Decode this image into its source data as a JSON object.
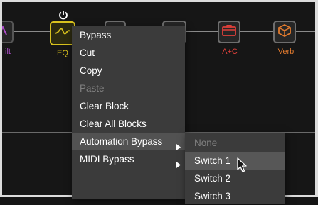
{
  "signal_chain": {
    "blocks": [
      {
        "label": "ilt",
        "color": "#b24fd0",
        "icon": "filter-icon"
      },
      {
        "label": "EQ",
        "color": "#d9c21e",
        "icon": "eq-curve-icon"
      },
      {
        "label": "A+C",
        "color": "#e0403a",
        "icon": "amp-cab-icon"
      },
      {
        "label": "Verb",
        "color": "#e07a2e",
        "icon": "reverb-cube-icon"
      }
    ]
  },
  "context_menu": {
    "items": [
      {
        "label": "Bypass",
        "enabled": true
      },
      {
        "label": "Cut",
        "enabled": true
      },
      {
        "label": "Copy",
        "enabled": true
      },
      {
        "label": "Paste",
        "enabled": false
      },
      {
        "label": "Clear Block",
        "enabled": true
      },
      {
        "label": "Clear All Blocks",
        "enabled": true
      },
      {
        "label": "Automation Bypass",
        "enabled": true,
        "has_submenu": true,
        "active": true
      },
      {
        "label": "MIDI Bypass",
        "enabled": true,
        "has_submenu": true
      }
    ]
  },
  "submenu": {
    "items": [
      {
        "label": "None",
        "enabled": false
      },
      {
        "label": "Switch 1",
        "enabled": true,
        "highlighted": true
      },
      {
        "label": "Switch 2",
        "enabled": true
      },
      {
        "label": "Switch 3",
        "enabled": true
      }
    ]
  },
  "colors": {
    "menu_bg": "#3b3b3b",
    "highlight": "#575757",
    "eq_accent": "#d9c21e"
  }
}
